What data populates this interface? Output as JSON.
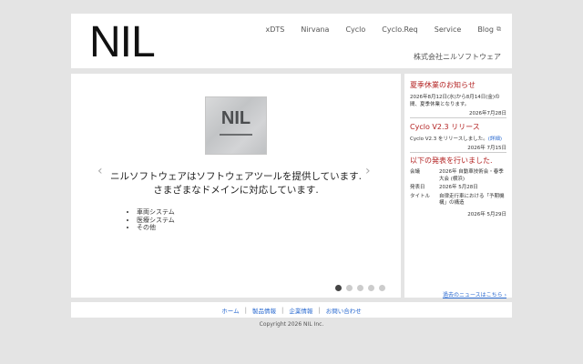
{
  "header": {
    "logo": "NIL",
    "company": "株式会社ニルソフトウェア",
    "nav": [
      "xDTS",
      "Nirvana",
      "Cyclo",
      "Cyclo.Req",
      "Service",
      "Blog"
    ],
    "blog_external_icon": "external-link-icon"
  },
  "slider": {
    "image_text": "NIL",
    "caption_line1": "ニルソフトウェアはソフトウェアツールを提供しています.",
    "caption_line2": "さまざまなドメインに対応しています.",
    "bullets": [
      "車両システム",
      "医療システム",
      "その他"
    ],
    "prev": "‹",
    "next": "›",
    "slide_count": 5,
    "active_slide": 1
  },
  "news": {
    "item1": {
      "title": "夏季休業のお知らせ",
      "body": "2026年8月12日(水)から8月14日(金)の間、夏季休業となります。",
      "date": "2026年7月28日"
    },
    "item2": {
      "title": "Cyclo V2.3 リリース",
      "body": "Cyclo V2.3 をリリースしました。",
      "link": "(詳細)",
      "date": "2026年 7月15日"
    },
    "item3": {
      "title": "以下の発表を行いました.",
      "rows": [
        {
          "k": "会議",
          "v": "2026年 自動車技術会・春季大会 (横浜)"
        },
        {
          "k": "発表日",
          "v": "2026年 5月28日"
        },
        {
          "k": "タイトル",
          "v": "自律走行車における「予期機構」の構造"
        }
      ],
      "date": "2026年 5月29日"
    },
    "more": "過去のニュースはこちら ›"
  },
  "footer": {
    "links": [
      "ホーム",
      "製品情報",
      "企業情報",
      "お問い合わせ"
    ],
    "copyright": "Copyright 2026 NIL Inc."
  }
}
